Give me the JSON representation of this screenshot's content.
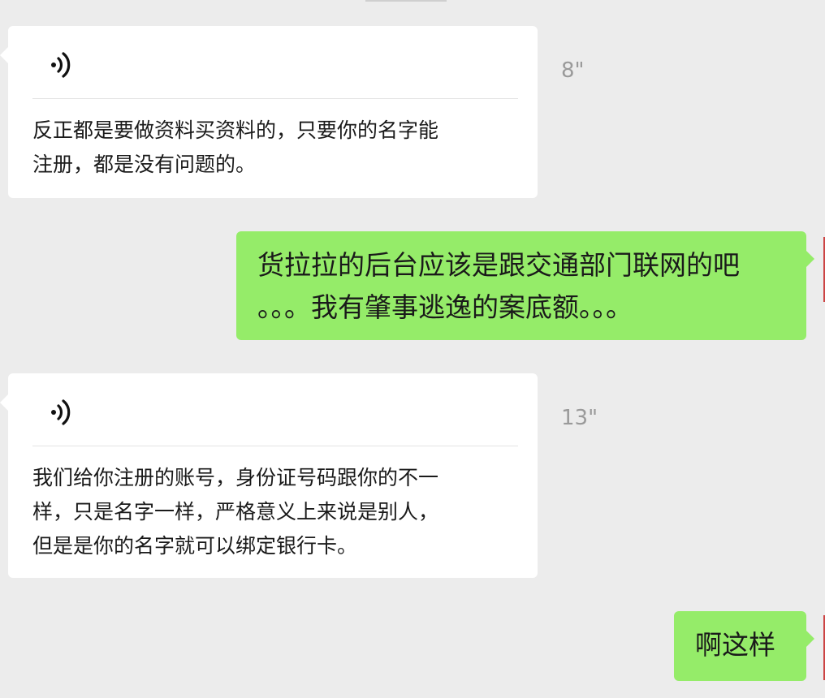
{
  "chat": {
    "messages": [
      {
        "direction": "incoming",
        "type": "voice",
        "icon": "voice-message-icon",
        "duration": "8\"",
        "transcript": "反正都是要做资料买资料的，只要你的名字能\n注册，都是没有问题的。"
      },
      {
        "direction": "outgoing",
        "type": "text",
        "text": "货拉拉的后台应该是跟交通部门联网的吧\n。。。我有肇事逃逸的案底额。。。"
      },
      {
        "direction": "incoming",
        "type": "voice",
        "icon": "voice-message-icon",
        "duration": "13\"",
        "transcript": "我们给你注册的账号，身份证号码跟你的不一\n样，只是名字一样，严格意义上来说是别人，\n但是是你的名字就可以绑定银行卡。"
      },
      {
        "direction": "outgoing",
        "type": "text",
        "text": "啊这样"
      }
    ]
  },
  "colors": {
    "background": "#ececec",
    "incoming_bubble": "#ffffff",
    "outgoing_bubble": "#95ec69",
    "duration_text": "#9a9a9a"
  }
}
